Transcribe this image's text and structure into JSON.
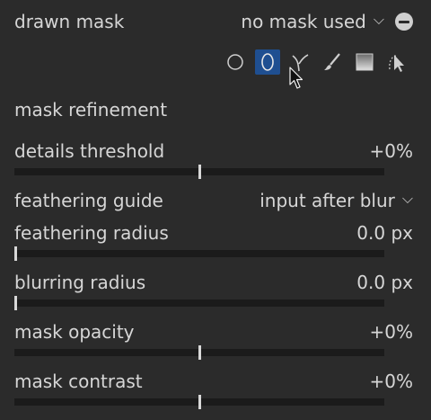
{
  "header": {
    "title": "drawn mask",
    "mask_status": "no mask used"
  },
  "tools": [
    {
      "icon": "circle-icon",
      "label": "circle"
    },
    {
      "icon": "ellipse-icon",
      "label": "ellipse"
    },
    {
      "icon": "path-icon",
      "label": "path"
    },
    {
      "icon": "brush-icon",
      "label": "brush"
    },
    {
      "icon": "gradient-icon",
      "label": "gradient"
    },
    {
      "icon": "show-edit-masks-icon",
      "label": "show and edit mask elements"
    }
  ],
  "refinement": {
    "title": "mask refinement",
    "details_threshold": {
      "label": "details threshold",
      "value": "+0%",
      "fraction": 0.5
    },
    "feathering_guide": {
      "label": "feathering guide",
      "value": "input after blur"
    },
    "feathering_radius": {
      "label": "feathering radius",
      "value": "0.0 px",
      "fraction": 0.0
    },
    "blurring_radius": {
      "label": "blurring radius",
      "value": "0.0 px",
      "fraction": 0.0
    },
    "mask_opacity": {
      "label": "mask opacity",
      "value": "+0%",
      "fraction": 0.5
    },
    "mask_contrast": {
      "label": "mask contrast",
      "value": "+0%",
      "fraction": 0.5
    }
  },
  "colors": {
    "background": "#2b2b2b",
    "text": "#d6d6d6",
    "active_tool": "#1f4f91",
    "slider_track": "#1b1b1b"
  }
}
